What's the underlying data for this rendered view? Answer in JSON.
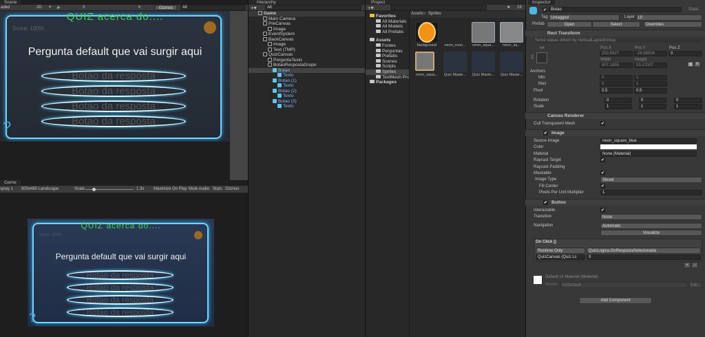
{
  "scene": {
    "tab": "Scene",
    "shading": "aded",
    "mode2d": "2D",
    "gizmos": "Gizmos",
    "search_placeholder": "All",
    "layers_count": "0"
  },
  "quiz": {
    "title": "QUIZ acerca do....",
    "score": "Score: 100%",
    "question": "Pergunta default que vai surgir aqui",
    "answers": [
      "Botao da resposta",
      "Botao da resposta",
      "Botao da resposta",
      "Botao da resposta"
    ],
    "help": "?"
  },
  "game": {
    "tab": "Game",
    "display": "splay 1",
    "resolution": "800x480 Landscape",
    "scale_label": "Scale",
    "scale_value": "1.3x",
    "maximize": "Maximize On Play",
    "mute": "Mute Audio",
    "stats": "Stats",
    "gizmos": "Gizmos"
  },
  "hierarchy": {
    "tab": "Hierarchy",
    "search_placeholder": "All",
    "items": [
      {
        "label": "Game",
        "depth": 0,
        "kind": "scene"
      },
      {
        "label": "Main Camera",
        "depth": 1
      },
      {
        "label": "PreCanvas",
        "depth": 1
      },
      {
        "label": "Image",
        "depth": 2
      },
      {
        "label": "EventSystem",
        "depth": 1
      },
      {
        "label": "BackCanvas",
        "depth": 1
      },
      {
        "label": "Image",
        "depth": 2
      },
      {
        "label": "Text (TMP)",
        "depth": 2
      },
      {
        "label": "QuizCanvas",
        "depth": 1
      },
      {
        "label": "PerguntaTexto",
        "depth": 2
      },
      {
        "label": "BotaoRespostaGrupo",
        "depth": 2
      },
      {
        "label": "Botao",
        "depth": 3,
        "prefab": true,
        "selected": true
      },
      {
        "label": "Texto",
        "depth": 4,
        "prefab": true
      },
      {
        "label": "Botao (1)",
        "depth": 3,
        "prefab": true
      },
      {
        "label": "Texto",
        "depth": 4,
        "prefab": true
      },
      {
        "label": "Botao (2)",
        "depth": 3,
        "prefab": true
      },
      {
        "label": "Texto",
        "depth": 4,
        "prefab": true
      },
      {
        "label": "Botao (3)",
        "depth": 3,
        "prefab": true
      },
      {
        "label": "Texto",
        "depth": 4,
        "prefab": true
      }
    ]
  },
  "project": {
    "tab": "Project",
    "hidden_count": "19",
    "breadcrumb": [
      "Assets",
      "Sprites"
    ],
    "tree": [
      {
        "label": "Favorites",
        "depth": 0,
        "bold": true
      },
      {
        "label": "All Materials",
        "depth": 1
      },
      {
        "label": "All Models",
        "depth": 1
      },
      {
        "label": "All Prefabs",
        "depth": 1
      },
      {
        "label": "Assets",
        "depth": 0,
        "bold": true
      },
      {
        "label": "Fontes",
        "depth": 1
      },
      {
        "label": "Perguntas",
        "depth": 1
      },
      {
        "label": "Prefabs",
        "depth": 1
      },
      {
        "label": "Scenes",
        "depth": 1
      },
      {
        "label": "Scripts",
        "depth": 1
      },
      {
        "label": "Sprites",
        "depth": 1,
        "selected": true
      },
      {
        "label": "TextMesh Pro",
        "depth": 1
      },
      {
        "label": "Packages",
        "depth": 0,
        "bold": true
      }
    ],
    "assets": [
      "background",
      "neon_roun...",
      "neon_squa...",
      "neon_sq...",
      "neon_squa...",
      "Quiz Maste...",
      "Quiz Maste...",
      "Quiz Maste..."
    ]
  },
  "inspector": {
    "tab": "Inspector",
    "name": "Botao",
    "static": "Static",
    "tag_label": "Tag",
    "tag": "Untagged",
    "layer_label": "Layer",
    "layer": "UI",
    "prefab_label": "Prefab",
    "open": "Open",
    "select": "Select",
    "overrides": "Overrides",
    "rect": {
      "title": "Rect Transform",
      "note": "Some values driven by VerticalLayoutGroup.",
      "anchor_h": "left",
      "anchor_v": "top",
      "posx_label": "Pos X",
      "posy_label": "Pos Y",
      "posz_label": "Pos Z",
      "posx": "253.5927",
      "posy": "-26.58504",
      "posz": "0",
      "width_label": "Width",
      "height_label": "Height",
      "width": "507.1855",
      "height": "53.17007",
      "anchors": "Anchors",
      "min": "Min",
      "max": "Max",
      "min_x": "0",
      "min_y": "1",
      "max_x": "0",
      "max_y": "1",
      "pivot": "Pivot",
      "pivot_x": "0.5",
      "pivot_y": "0.5",
      "rotation": "Rotation",
      "rot": [
        "0",
        "0",
        "0"
      ],
      "scale": "Scale",
      "scl": [
        "1",
        "1",
        "1"
      ]
    },
    "canvas_renderer": {
      "title": "Canvas Renderer",
      "cull": "Cull Transparent Mesh"
    },
    "image": {
      "title": "Image",
      "source_label": "Source Image",
      "source": "neon_square_blue",
      "color_label": "Color",
      "color": "#ffffff",
      "material_label": "Material",
      "material": "None (Material)",
      "raycast_target": "Raycast Target",
      "raycast_padding": "Raycast Padding",
      "maskable": "Maskable",
      "image_type_label": "Image Type",
      "image_type": "Sliced",
      "fill_center": "Fill Center",
      "ppu_label": "Pixels Per Unit Multiplier",
      "ppu": "1"
    },
    "button": {
      "title": "Button",
      "interactable": "Interactable",
      "transition_label": "Transition",
      "transition": "None",
      "navigation_label": "Navigation",
      "navigation": "Automatic",
      "visualize": "Visualize",
      "onclick": "On Click ()",
      "runtime": "Runtime Only",
      "function": "QuizLogica.OnRespostaSelecionada",
      "target": "QuizCanvas (Quiz Lc",
      "arg": "0",
      "plus": "+",
      "minus": "−"
    },
    "material": {
      "title": "Default UI Material (Material)",
      "shader_label": "Shader",
      "shader": "UI/Default",
      "edit": "Edit..."
    },
    "add_component": "Add Component"
  }
}
